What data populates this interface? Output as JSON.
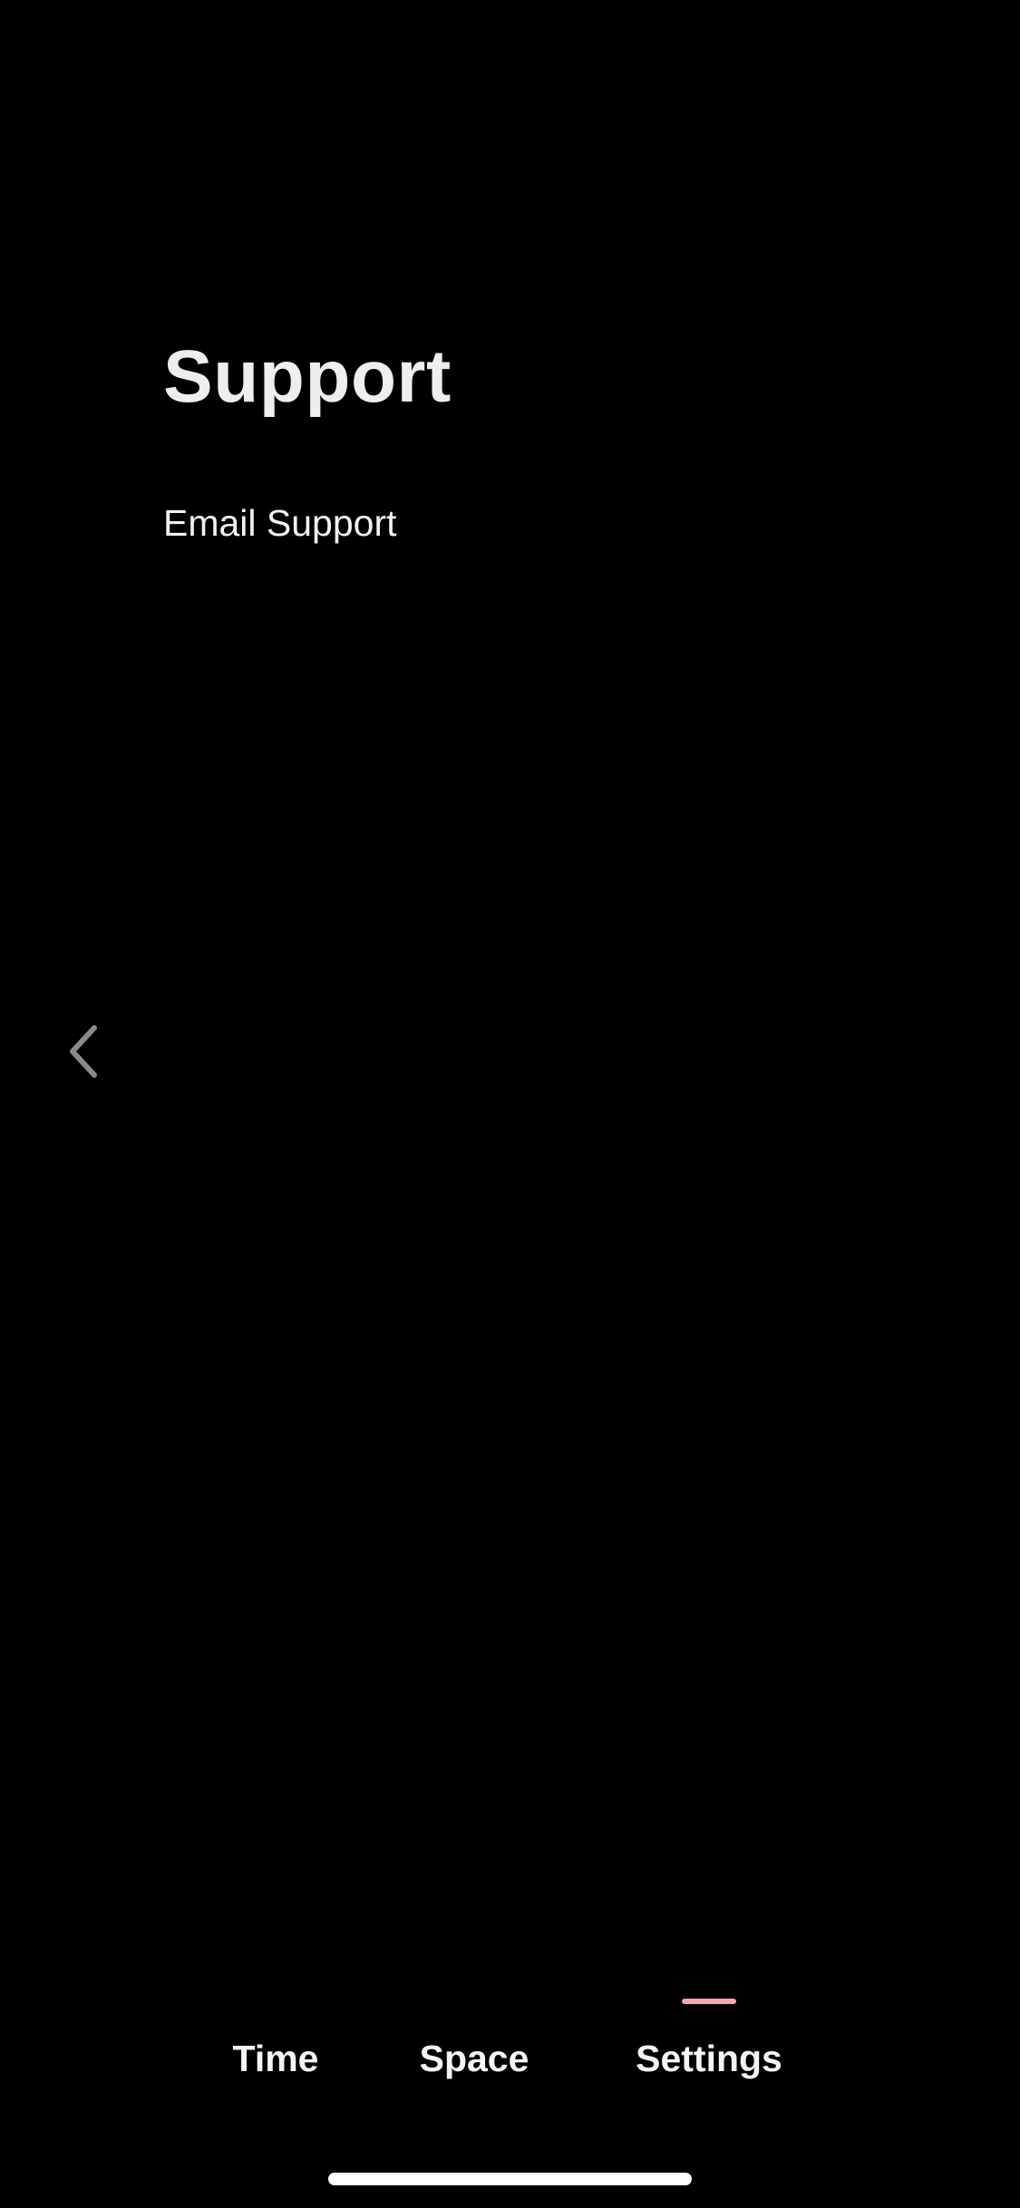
{
  "page": {
    "title": "Support"
  },
  "support": {
    "items": [
      {
        "label": "Email Support"
      }
    ]
  },
  "navigation": {
    "back_icon": "chevron-left-icon"
  },
  "tabs": [
    {
      "label": "Time",
      "active": false
    },
    {
      "label": "Space",
      "active": false
    },
    {
      "label": "Settings",
      "active": true
    }
  ],
  "colors": {
    "background": "#000000",
    "text": "#ffffff",
    "active_indicator": "#f4a6ae",
    "back_icon": "#8a8a8a"
  }
}
